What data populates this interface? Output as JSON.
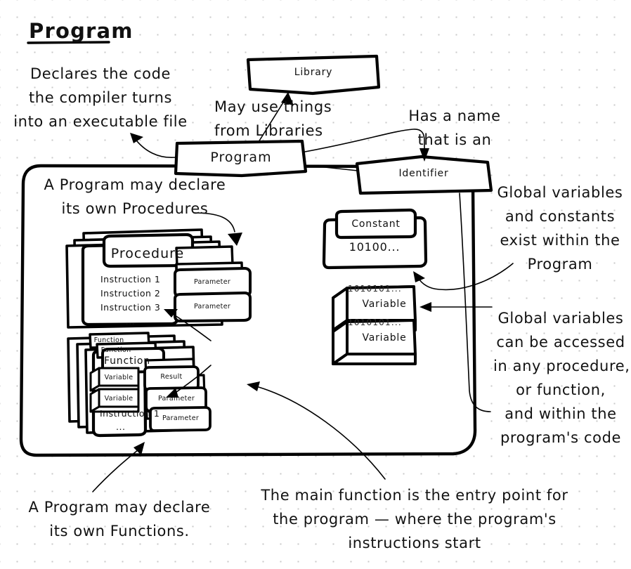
{
  "page": {
    "title": "Program",
    "background": "#ffffff",
    "ink_color": "#000000",
    "dot_grid_color": "#c9c9c9"
  },
  "notes": {
    "declares": "Declares the code\nthe compiler turns\ninto an executable file",
    "may_use_libraries": "May use things\nfrom Libraries",
    "has_a_name": "Has a name\nthat is an",
    "program_may_declare_procedures": "A Program may declare\nits own Procedures",
    "global_exist": "Global variables\nand constants\nexist within the\nProgram",
    "global_accessed": "Global variables\ncan be accessed\nin any procedure,\nor function,\nand within the\nprogram's code",
    "program_may_declare_functions": "A Program may declare\nits own Functions.",
    "main_function": "The main function is the entry point for\nthe program — where the program's\ninstructions start"
  },
  "nodes": {
    "library": {
      "label": "Library"
    },
    "program": {
      "label": "Program"
    },
    "identifier": {
      "label": "Identifier"
    },
    "constant": {
      "label": "Constant",
      "value": "10100..."
    },
    "global_variables": [
      {
        "label": "Variable",
        "bits": "1010101..."
      },
      {
        "label": "Variable",
        "bits": "1010101..."
      }
    ],
    "procedure": {
      "label": "Procedure",
      "instructions": "Instruction 1\nInstruction 2\nInstruction 3\n        ...",
      "parameters": [
        "Parameter",
        "Parameter"
      ]
    },
    "function": {
      "labels": [
        "Function",
        "Function",
        "Function"
      ],
      "result": "Result",
      "parameters": [
        "Parameter",
        "Parameter"
      ],
      "variables": [
        "Variable",
        "Variable"
      ],
      "instructions": "Instruction 1",
      "ellipsis": "..."
    }
  }
}
